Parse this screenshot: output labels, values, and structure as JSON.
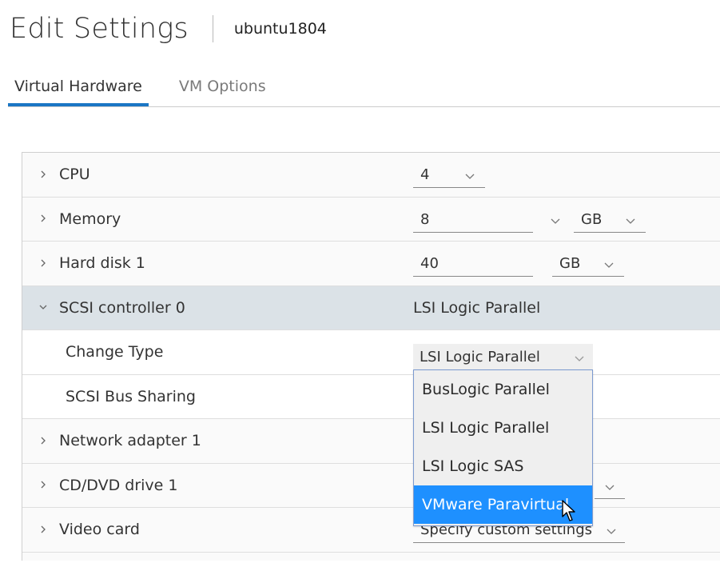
{
  "header": {
    "title": "Edit Settings",
    "vm_name": "ubuntu1804"
  },
  "tabs": [
    {
      "label": "Virtual Hardware",
      "active": true
    },
    {
      "label": "VM Options",
      "active": false
    }
  ],
  "hardware": {
    "cpu": {
      "label": "CPU",
      "value": "4"
    },
    "memory": {
      "label": "Memory",
      "value": "8",
      "unit": "GB"
    },
    "hard_disk": {
      "label": "Hard disk 1",
      "value": "40",
      "unit": "GB"
    },
    "scsi": {
      "label": "SCSI controller 0",
      "value": "LSI Logic Parallel"
    },
    "change_type": {
      "label": "Change Type",
      "value": "LSI Logic Parallel"
    },
    "bus_sharing": {
      "label": "SCSI Bus Sharing"
    },
    "network": {
      "label": "Network adapter 1"
    },
    "cddvd": {
      "label": "CD/DVD drive 1"
    },
    "video": {
      "label": "Video card",
      "value": "Specify custom settings"
    }
  },
  "dropdown": {
    "options": [
      "BusLogic Parallel",
      "LSI Logic Parallel",
      "LSI Logic SAS",
      "VMware Paravirtual"
    ],
    "highlighted": "VMware Paravirtual"
  },
  "colors": {
    "accent": "#1b76c4",
    "selected_option": "#1e90ff",
    "expanded_row": "#dbe2e7"
  },
  "icons": {
    "collapsed": "chevron-right-icon",
    "expanded": "chevron-down-icon",
    "select": "chevron-down-icon",
    "pointer": "mouse-cursor-icon"
  }
}
